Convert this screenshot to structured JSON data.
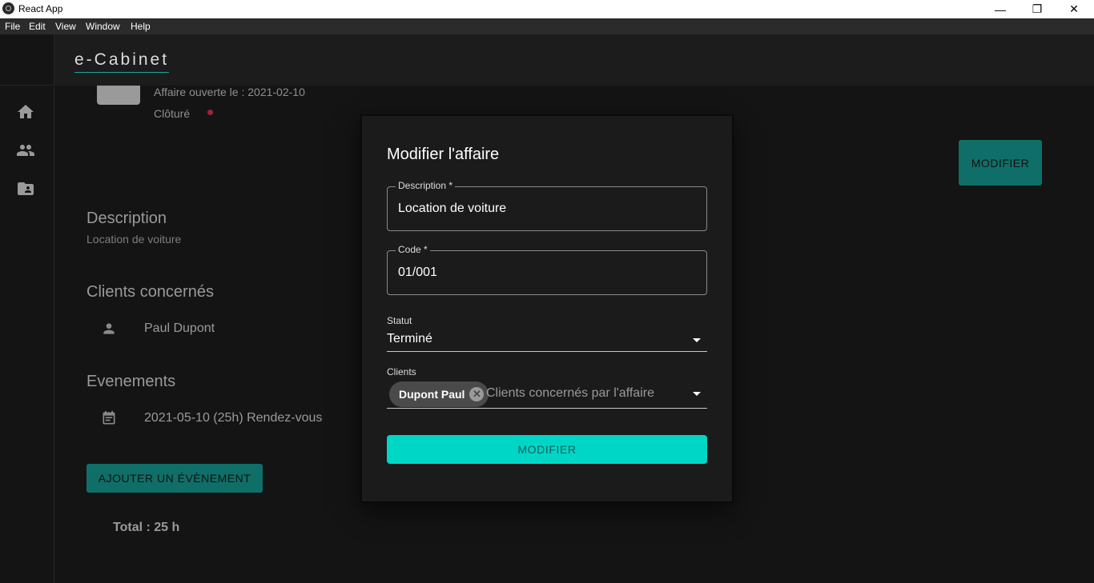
{
  "window": {
    "title": "React App",
    "controls": {
      "minimize": "—",
      "restore": "❐",
      "close": "✕"
    }
  },
  "menu": [
    "File",
    "Edit",
    "View",
    "Window",
    "Help"
  ],
  "app": {
    "brand": "e-Cabinet"
  },
  "affair": {
    "opened": "Affaire ouverte le : 2021-02-10",
    "status": "Clôturé",
    "status_color": "#a0233a",
    "modify_label": "MODIFIER",
    "description_heading": "Description",
    "description": "Location de voiture",
    "clients_heading": "Clients concernés",
    "clients": [
      "Paul Dupont"
    ],
    "events_heading": "Evenements",
    "events": [
      "2021-05-10 (25h) Rendez-vous"
    ],
    "add_event_label": "AJOUTER UN ÉVÈNEMENT",
    "total": "Total : 25 h"
  },
  "dialog": {
    "title": "Modifier l'affaire",
    "description": {
      "label": "Description *",
      "value": "Location de voiture"
    },
    "code": {
      "label": "Code *",
      "value": "01/001"
    },
    "statut": {
      "label": "Statut",
      "value": "Terminé"
    },
    "clients": {
      "label": "Clients",
      "chips": [
        "Dupont Paul"
      ],
      "placeholder": "Clients concernés par l'affaire"
    },
    "submit_label": "MODIFIER",
    "accent": "#00d6c5"
  }
}
